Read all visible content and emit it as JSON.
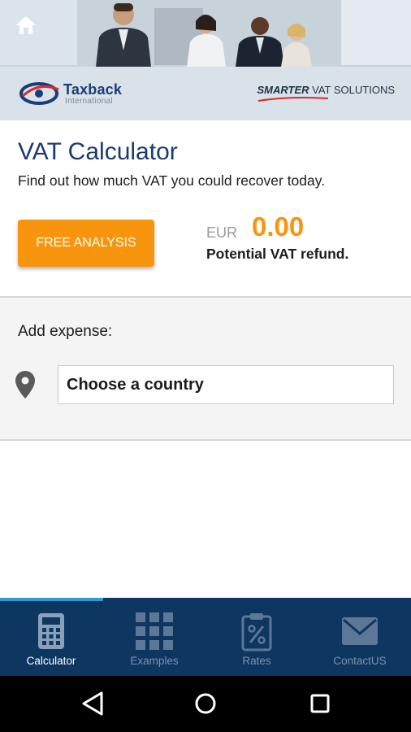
{
  "header": {
    "brand_name": "Taxback",
    "brand_sub": "International",
    "tagline_bold": "SMARTER",
    "tagline_rest": " VAT SOLUTIONS",
    "icons": {
      "home": "home-icon",
      "logo": "taxback-globe-logo"
    }
  },
  "calculator": {
    "title": "VAT Calculator",
    "subtitle": "Find out how much VAT you could recover today.",
    "free_analysis_label": "FREE ANALYSIS",
    "currency": "EUR",
    "amount": "0.00",
    "refund_label": "Potential VAT refund."
  },
  "expense": {
    "label": "Add expense:",
    "country_value": "Choose a country",
    "pin_icon": "location-pin-icon"
  },
  "tabs": [
    {
      "label": "Calculator",
      "icon": "calculator-icon",
      "active": true
    },
    {
      "label": "Examples",
      "icon": "grid-icon",
      "active": false
    },
    {
      "label": "Rates",
      "icon": "percent-clipboard-icon",
      "active": false
    },
    {
      "label": "ContactUS",
      "icon": "envelope-icon",
      "active": false
    }
  ],
  "navbar": {
    "back": "back-triangle-icon",
    "home": "home-circle-icon",
    "recents": "recents-square-icon"
  },
  "colors": {
    "accent": "#f7960e",
    "title": "#1b3b6f",
    "tabbar": "#0d3661",
    "tab_indicator": "#2c9bd6"
  }
}
